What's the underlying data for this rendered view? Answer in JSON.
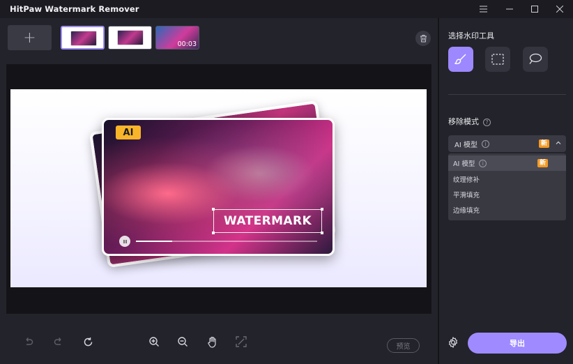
{
  "app": {
    "title": "HitPaw Watermark Remover"
  },
  "thumbnails": {
    "add_label": "+",
    "video_duration": "00:03"
  },
  "canvas": {
    "ai_badge": "AI",
    "watermark_text": "WATERMARK",
    "playback_progress": 0.2
  },
  "bottom": {
    "preview_label": "预览"
  },
  "panel": {
    "tools_title": "选择水印工具",
    "mode_title": "移除模式",
    "selected_mode": "AI 模型",
    "new_badge": "新",
    "options": [
      {
        "label": "AI 模型",
        "new": "新"
      },
      {
        "label": "纹理修补"
      },
      {
        "label": "平滑填充"
      },
      {
        "label": "边缘填充"
      }
    ],
    "export_label": "导出"
  },
  "colors": {
    "accent": "#9d88ff",
    "badge_orange": "#f59a23",
    "ai_yellow": "#f8b52a"
  }
}
